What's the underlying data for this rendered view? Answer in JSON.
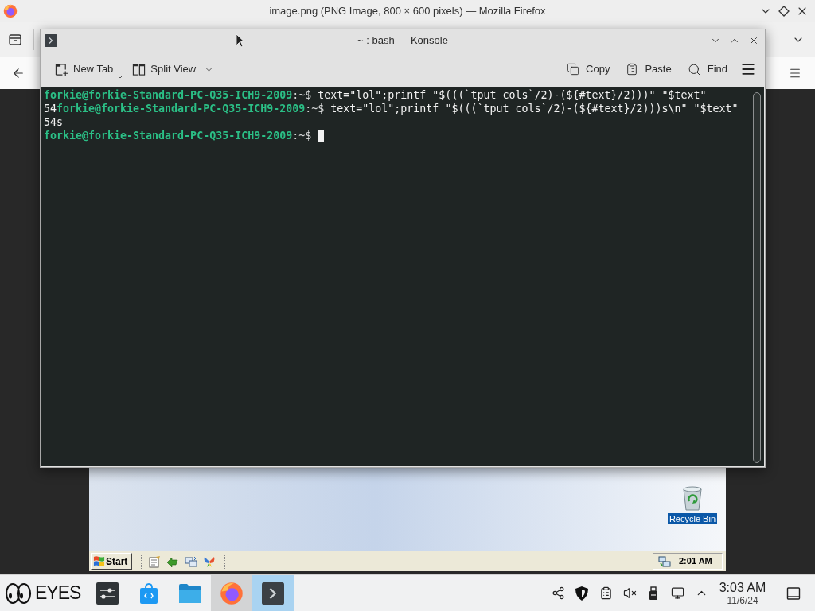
{
  "browser_window": {
    "title": "image.png (PNG Image, 800 × 600 pixels) — Mozilla Firefox"
  },
  "displayed_image": {
    "desktop_icons": [
      {
        "label": "Recycle Bin",
        "selected": true
      }
    ],
    "taskbar": {
      "start_label": "Start",
      "clock": "2:01 AM"
    }
  },
  "terminal_window": {
    "title": "~ : bash — Konsole",
    "toolbar_left": [
      {
        "label": "New Tab"
      },
      {
        "label": "Split View"
      }
    ],
    "toolbar_right": [
      {
        "label": "Copy"
      },
      {
        "label": "Paste"
      },
      {
        "label": "Find"
      }
    ]
  },
  "terminal_lines": [
    {
      "segments": [
        {
          "kind": "prompt_user",
          "text": "forkie@forkie-Standard-PC-Q35-ICH9-2009"
        },
        {
          "kind": "prompt_dir",
          "text": ":~$"
        },
        {
          "kind": "command",
          "text": "text=\"lol\";printf \"$(((`tput cols`/2)-(${#text}/2)))\" \"$text\""
        }
      ],
      "cursor": false
    },
    {
      "segments": [
        {
          "kind": "output",
          "text": "54"
        },
        {
          "kind": "prompt_user",
          "text": "forkie@forkie-Standard-PC-Q35-ICH9-2009"
        },
        {
          "kind": "prompt_dir",
          "text": ":~$"
        },
        {
          "kind": "command",
          "text": "text=\"lol\";printf \"$(((`tput cols`/2)-(${#text}/2)))s\\n\" \"$text\""
        }
      ],
      "cursor": false
    },
    {
      "segments": [
        {
          "kind": "output",
          "text": "54s"
        }
      ],
      "cursor": false
    },
    {
      "segments": [
        {
          "kind": "prompt_user",
          "text": "forkie@forkie-Standard-PC-Q35-ICH9-2009"
        },
        {
          "kind": "prompt_dir",
          "text": ":~$"
        }
      ],
      "cursor": true
    }
  ],
  "panel": {
    "launcher_label": "EYES",
    "tasks": [
      {
        "running": false,
        "selected": false
      },
      {
        "running": false,
        "selected": false
      },
      {
        "running": false,
        "selected": false
      },
      {
        "running": true,
        "selected": false
      },
      {
        "running": true,
        "selected": true
      }
    ],
    "clock_time": "3:03 AM",
    "clock_date": "11/6/24"
  }
}
